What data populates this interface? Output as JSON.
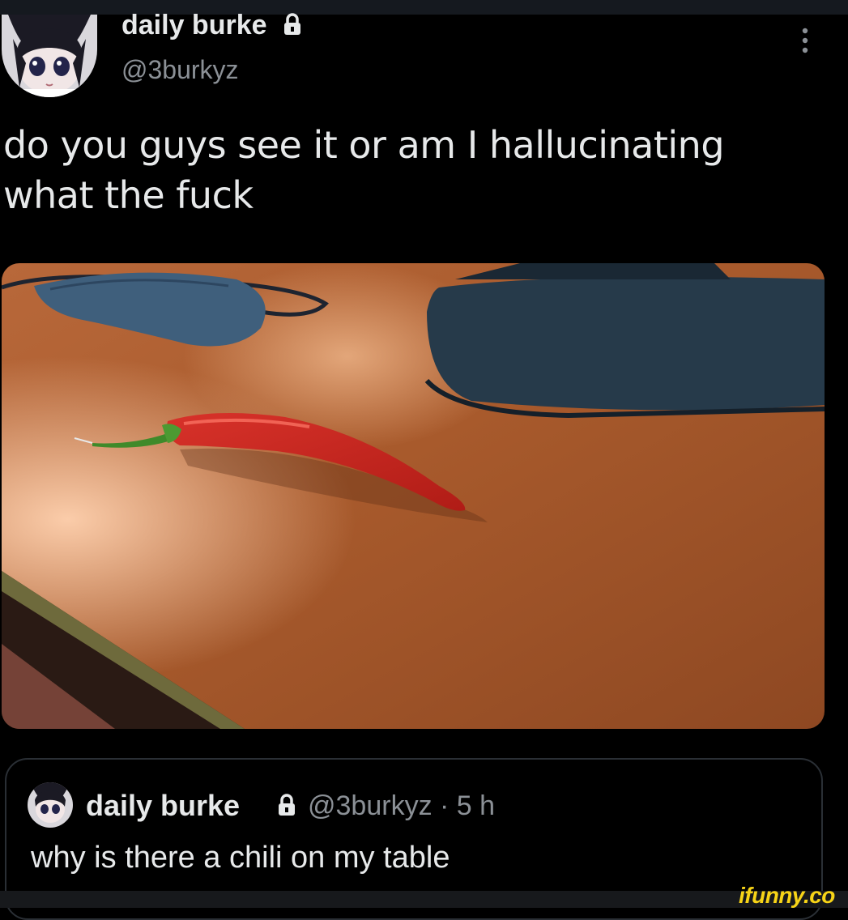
{
  "tweet": {
    "display_name": "daily burke",
    "handle": "@3burkyz",
    "text_lines": [
      "do you guys see it or am I hallucinating",
      "what the fuck"
    ],
    "protected_icon": "lock-icon",
    "menu_icon": "more-vertical-icon"
  },
  "media": {
    "subject": "red chili pepper on a wooden desk"
  },
  "quote": {
    "display_name": "daily burke",
    "handle_time": "@3burkyz · 5 h",
    "text": "why is there a chili on my table"
  },
  "watermark": {
    "text": "ifunny.co",
    "color": "#f7d417"
  }
}
